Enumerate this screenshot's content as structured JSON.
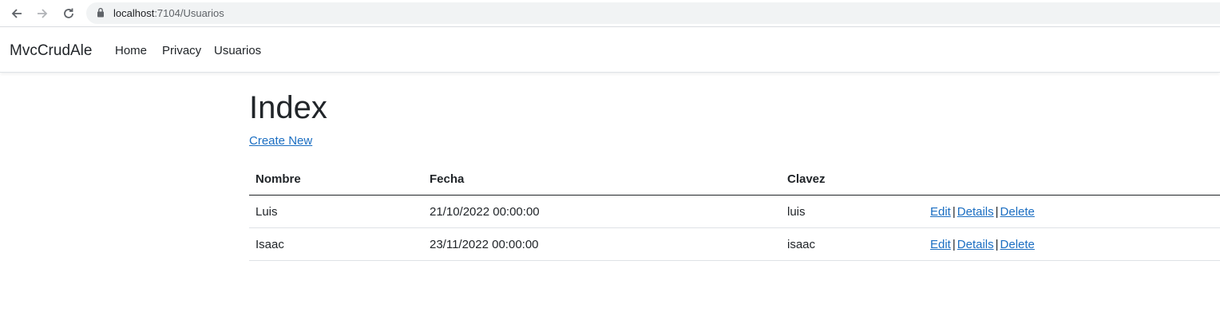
{
  "browser": {
    "url_host": "localhost",
    "url_path": ":7104/Usuarios"
  },
  "navbar": {
    "brand": "MvcCrudAle",
    "links": [
      {
        "label": "Home"
      },
      {
        "label": "Privacy"
      },
      {
        "label": "Usuarios"
      }
    ]
  },
  "page": {
    "title": "Index",
    "create_link": "Create New"
  },
  "table": {
    "headers": {
      "nombre": "Nombre",
      "fecha": "Fecha",
      "clavez": "Clavez"
    },
    "rows": [
      {
        "nombre": "Luis",
        "fecha": "21/10/2022 00:00:00",
        "clavez": "luis",
        "edit": "Edit",
        "sep1": "|",
        "details": "Details",
        "sep2": "|",
        "delete": "Delete"
      },
      {
        "nombre": "Isaac",
        "fecha": "23/11/2022 00:00:00",
        "clavez": "isaac",
        "edit": "Edit",
        "sep1": "|",
        "details": "Details",
        "sep2": "|",
        "delete": "Delete"
      }
    ]
  },
  "colors": {
    "link": "#1b6ec2",
    "text": "#212529"
  },
  "icons": [
    "back-arrow-icon",
    "forward-arrow-icon",
    "reload-icon",
    "lock-icon"
  ]
}
